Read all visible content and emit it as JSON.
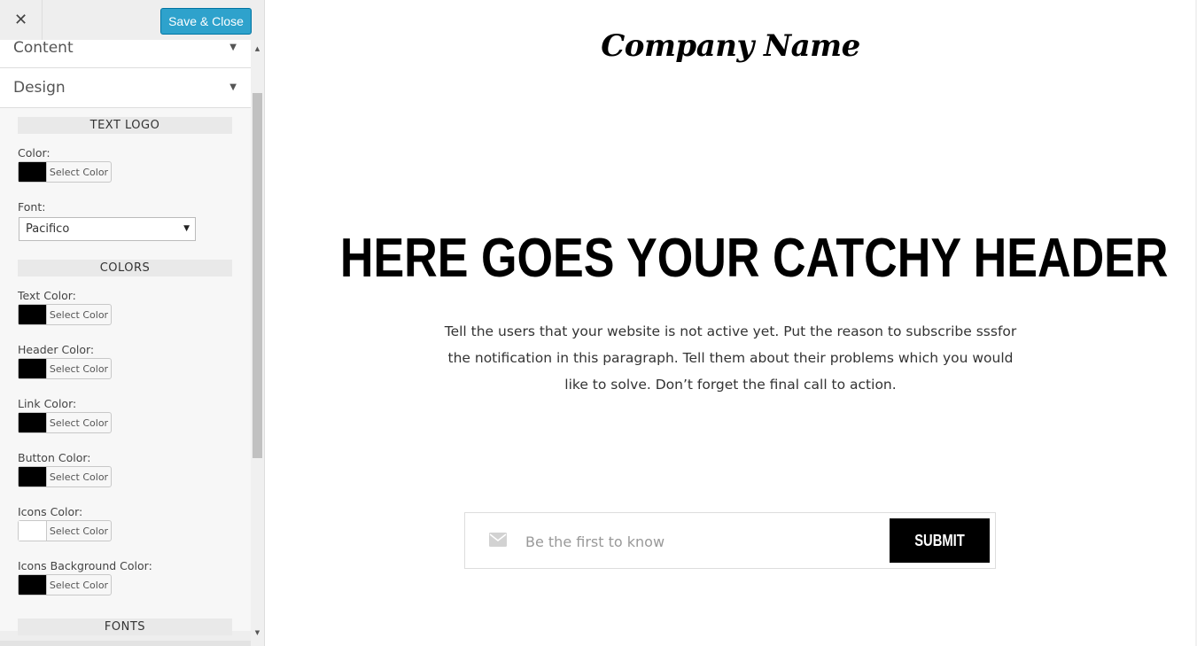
{
  "sidebar": {
    "close_icon_glyph": "✕",
    "save_label": "Save & Close",
    "accordions": [
      {
        "label": "Content"
      },
      {
        "label": "Design"
      }
    ],
    "sections": {
      "text_logo": "TEXT LOGO",
      "colors": "COLORS",
      "fonts": "FONTS"
    },
    "picker_text": "Select Color",
    "logo_color": {
      "label": "Color:",
      "value": "#000000"
    },
    "font": {
      "label": "Font:",
      "value": "Pacifico"
    },
    "color_fields": [
      {
        "label": "Text Color:",
        "value": "#000000"
      },
      {
        "label": "Header Color:",
        "value": "#000000"
      },
      {
        "label": "Link Color:",
        "value": "#000000"
      },
      {
        "label": "Button Color:",
        "value": "#000000"
      },
      {
        "label": "Icons Color:",
        "value": "#ffffff"
      },
      {
        "label": "Icons Background Color:",
        "value": "#000000"
      }
    ]
  },
  "preview": {
    "logo": "Company Name",
    "headline": "HERE GOES YOUR CATCHY HEADER",
    "paragraph": "Tell the users that your website is not active yet. Put the reason to subscribe sssfor the notification in this paragraph. Tell them about their problems which you would like to solve. Don’t forget the final call to action.",
    "email_placeholder": "Be the first to know",
    "submit_label": "SUBMIT"
  },
  "colors": {
    "accent": "#2ea2cc",
    "button_bg": "#000000"
  }
}
